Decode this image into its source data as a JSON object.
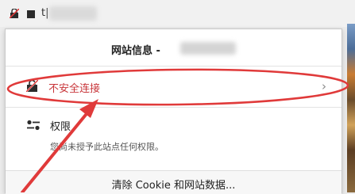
{
  "tab": {
    "text": "t|"
  },
  "popup": {
    "title": "网站信息 -",
    "connection": {
      "label": "不安全连接",
      "chevron": "›"
    },
    "permissions": {
      "title": "权限",
      "description": "您尚未授予此站点任何权限。"
    },
    "clear_button": "清除 Cookie 和网站数据..."
  },
  "colors": {
    "warning_text": "#c8363a",
    "annotation": "#e03a3a"
  }
}
